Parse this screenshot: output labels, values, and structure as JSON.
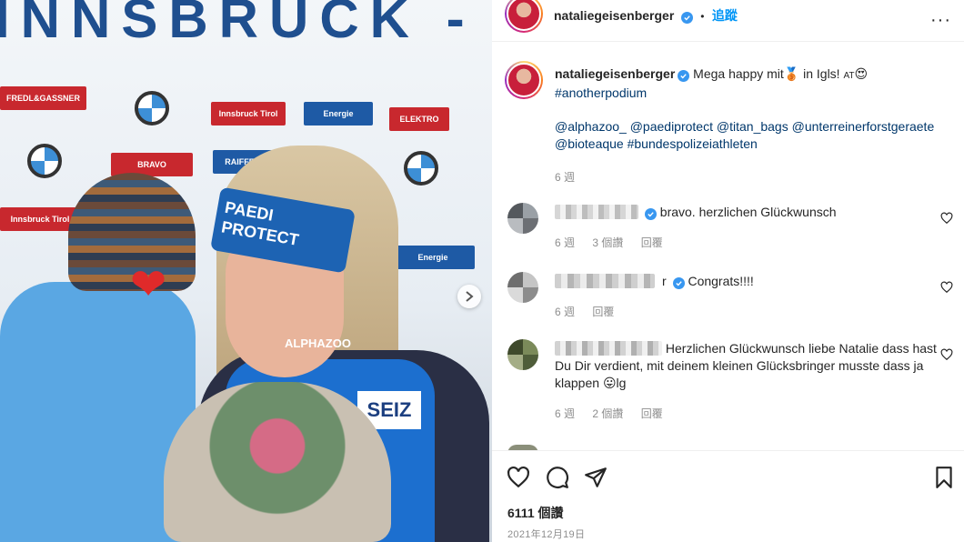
{
  "photo": {
    "banner_text": "INNSBRUCK - IGL",
    "logos": [
      "FREDL&GASSNER",
      "Innsbruck Tirol",
      "Energie",
      "ELEKTRO",
      "BRAVO",
      "RAIFFEISEN",
      "Innsbruck Tirol",
      "Energie"
    ],
    "headband_text": "PAEDI\nPROTECT",
    "bib_text": "SEIZ",
    "jersey_text": "ALPHAZOO",
    "heart_glyph": "❤"
  },
  "header": {
    "username": "nataliegeisenberger",
    "separator": "•",
    "follow_label": "追蹤",
    "more_label": "···"
  },
  "caption": {
    "username": "nataliegeisenberger",
    "text_before": "Mega happy mit",
    "medal_emoji": "🥉",
    "text_after": " in Igls! ",
    "flag_label": "AT",
    "emoji": "😍",
    "hashtag1": "#anotherpodium",
    "mentions": [
      "@alphazoo_",
      "@paediprotect",
      "@titan_bags",
      "@unterreinerforstgeraete",
      "@bioteaque"
    ],
    "hashtag2": "#bundespolizeiathleten",
    "time": "6 週"
  },
  "comments": [
    {
      "text": "bravo. herzlichen Glückwunsch",
      "time": "6 週",
      "likes": "3 個讚",
      "reply": "回覆"
    },
    {
      "name_suffix": "r",
      "text": "Congrats!!!!",
      "time": "6 週",
      "reply": "回覆"
    },
    {
      "text": "Herzlichen Glückwunsch liebe Natalie dass hast Du Dir verdient, mit deinem kleinen Glücksbringer musste dass ja klappen ",
      "emoji": "😛",
      "text_end": "lg",
      "time": "6 週",
      "likes": "2 個讚",
      "reply": "回覆"
    }
  ],
  "footer": {
    "views": "6111 個讚",
    "date": "2021年12月19日"
  },
  "colors": {
    "accent": "#0095f6",
    "link": "#00376b",
    "muted": "#8e8e8e",
    "verified": "#3897f0"
  }
}
